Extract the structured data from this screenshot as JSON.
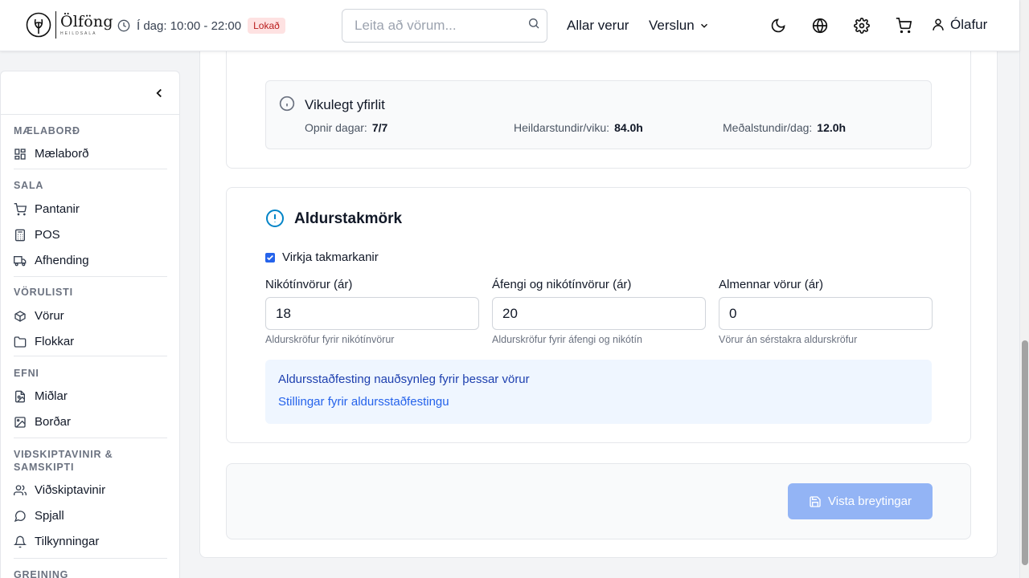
{
  "header": {
    "brand": "Ölföng",
    "brand_sub": "HEILDSALA",
    "hours": "Í dag: 10:00 - 22:00",
    "status_badge": "Lokað",
    "search_placeholder": "Leita að vörum...",
    "nav_all_products": "Allar verur",
    "nav_store": "Verslun",
    "user_name": "Ólafur",
    "icons": [
      "moon-icon",
      "globe-icon",
      "gear-icon",
      "cart-icon",
      "user-icon"
    ]
  },
  "sidebar": {
    "sections": [
      {
        "title": "MÆLABORÐ",
        "items": [
          {
            "label": "Mælaborð",
            "icon": "dashboard-icon"
          }
        ]
      },
      {
        "title": "SALA",
        "items": [
          {
            "label": "Pantanir",
            "icon": "cart-icon"
          },
          {
            "label": "POS",
            "icon": "calculator-icon"
          },
          {
            "label": "Afhending",
            "icon": "truck-icon"
          }
        ]
      },
      {
        "title": "VÖRULISTI",
        "items": [
          {
            "label": "Vörur",
            "icon": "box-icon"
          },
          {
            "label": "Flokkar",
            "icon": "folder-icon"
          }
        ]
      },
      {
        "title": "EFNI",
        "items": [
          {
            "label": "Miðlar",
            "icon": "media-icon"
          },
          {
            "label": "Borðar",
            "icon": "image-icon"
          }
        ]
      },
      {
        "title_line1": "VIÐSKIPTAVINIR &",
        "title_line2": "SAMSKIPTI",
        "items": [
          {
            "label": "Viðskiptavinir",
            "icon": "users-icon"
          },
          {
            "label": "Spjall",
            "icon": "chat-icon"
          },
          {
            "label": "Tilkynningar",
            "icon": "bell-icon"
          }
        ]
      },
      {
        "title": "GREINING"
      }
    ]
  },
  "weekly": {
    "title": "Vikulegt yfirlit",
    "open_days_label": "Opnir dagar:",
    "open_days_value": "7/7",
    "total_hours_label": "Heildarstundir/viku:",
    "total_hours_value": "84.0h",
    "avg_hours_label": "Meðalstundir/dag:",
    "avg_hours_value": "12.0h"
  },
  "age_limits": {
    "title": "Aldurstakmörk",
    "enable_label": "Virkja takmarkanir",
    "enabled": true,
    "fields": [
      {
        "label": "Nikótínvörur (ár)",
        "value": "18",
        "help": "Aldurskröfur fyrir nikótínvörur"
      },
      {
        "label": "Áfengi og nikótínvörur (ár)",
        "value": "20",
        "help": "Aldurskröfur fyrir áfengi og nikótín"
      },
      {
        "label": "Almennar vörur (ár)",
        "value": "0",
        "help": "Vörur án sérstakra aldurskröfur"
      }
    ],
    "notice_title": "Aldursstaðfesting nauðsynleg fyrir þessar vörur",
    "notice_link": "Stillingar fyrir aldursstaðfestingu"
  },
  "actions": {
    "save_label": "Vista breytingar"
  }
}
